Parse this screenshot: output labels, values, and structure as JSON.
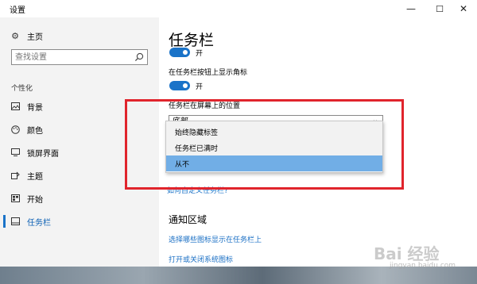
{
  "window": {
    "title": "设置",
    "minimize_glyph": "—",
    "maximize_glyph": "☐",
    "close_glyph": "✕"
  },
  "sidebar": {
    "home": {
      "label": "主页",
      "icon": "gear-icon"
    },
    "search": {
      "placeholder": "查找设置",
      "value": "查找设置",
      "icon": "search-icon"
    },
    "section_label": "个性化",
    "items": [
      {
        "label": "背景",
        "icon": "picture-icon",
        "active": false
      },
      {
        "label": "颜色",
        "icon": "palette-icon",
        "active": false
      },
      {
        "label": "锁屏界面",
        "icon": "monitor-icon",
        "active": false
      },
      {
        "label": "主题",
        "icon": "theme-icon",
        "active": false
      },
      {
        "label": "开始",
        "icon": "start-icon",
        "active": false
      },
      {
        "label": "任务栏",
        "icon": "taskbar-icon",
        "active": true
      }
    ]
  },
  "main": {
    "title": "任务栏",
    "toggle1": {
      "state_label": "开",
      "on": true
    },
    "badges_setting": {
      "label": "在任务栏按钮上显示角标"
    },
    "toggle2": {
      "state_label": "开",
      "on": true
    },
    "position_setting": {
      "label": "任务栏在屏幕上的位置",
      "selected_value": "底部"
    },
    "combine_menu": {
      "options": [
        "始终隐藏标签",
        "任务栏已满时",
        "从不"
      ],
      "selected_index": 2
    },
    "customize_link": "如何自定义任务栏?",
    "notification_section": {
      "title": "通知区域",
      "link1": "选择哪些图标显示在任务栏上",
      "link2": "打开或关闭系统图标"
    }
  },
  "colors": {
    "accent": "#1a73c8",
    "highlight_box": "#e0242c",
    "selected_option": "#71aee6",
    "link": "#1a6fc4"
  },
  "watermark": {
    "text": "Bai 经验",
    "sub": "jingyan.baidu.com"
  }
}
